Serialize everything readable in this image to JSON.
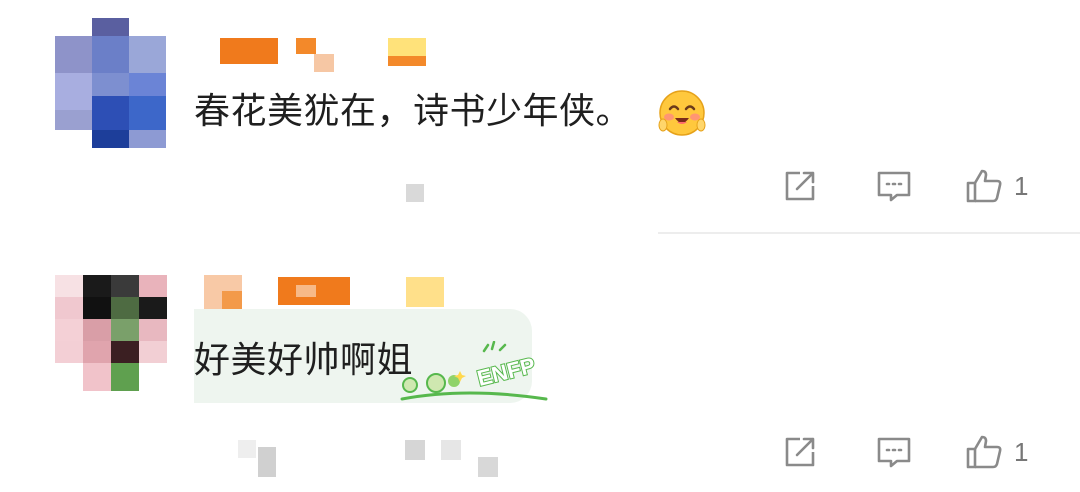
{
  "comments": [
    {
      "text": "春花美犹在，诗书少年侠。",
      "emoji_icon": "smiling-face-emoji-icon",
      "like_count": "1"
    },
    {
      "text": "好美好帅啊姐",
      "sticker_text": "ENFP",
      "like_count": "1"
    }
  ],
  "colors": {
    "text": "#1f1f1f",
    "icon": "#8a8a8a",
    "divider": "#ededed",
    "bubble": "#eef5ef",
    "sticker_green": "#57b84d"
  },
  "icons": {
    "share": "share-square-icon",
    "comment": "comment-bubble-icon",
    "like": "thumbs-up-icon"
  }
}
